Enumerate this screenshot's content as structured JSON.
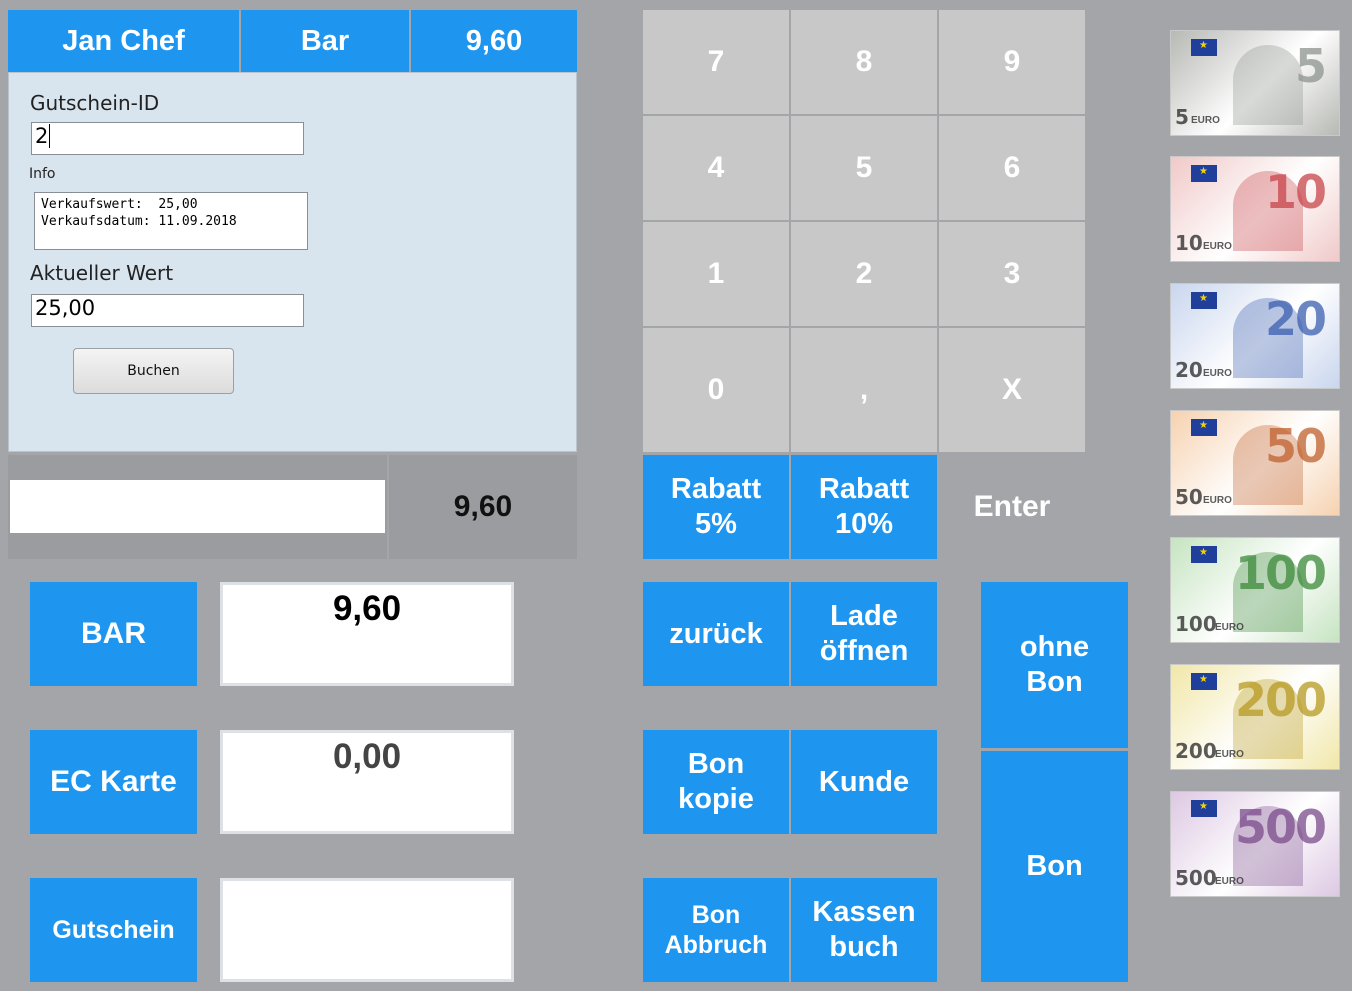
{
  "header": {
    "user": "Jan Chef",
    "mode": "Bar",
    "total": "9,60"
  },
  "voucher": {
    "id_label": "Gutschein-ID",
    "id_value": "2",
    "info_label": "Info",
    "info_lines": [
      "Verkaufswert:  25,00",
      "Verkaufsdatum: 11.09.2018"
    ],
    "current_label": "Aktueller Wert",
    "current_value": "25,00",
    "book_button": "Buchen"
  },
  "entry": {
    "value": "",
    "amount": "9,60"
  },
  "numpad": {
    "keys": [
      "7",
      "8",
      "9",
      "4",
      "5",
      "6",
      "1",
      "2",
      "3",
      "0",
      ",",
      "X"
    ],
    "discount5": [
      "Rabatt",
      "5%"
    ],
    "discount10": [
      "Rabatt",
      "10%"
    ],
    "enter": "Enter"
  },
  "payments": [
    {
      "label": "BAR",
      "value": "9,60"
    },
    {
      "label": "EC Karte",
      "value": "0,00"
    },
    {
      "label": "Gutschein",
      "value": ""
    }
  ],
  "actions": {
    "back": "zurück",
    "open_drawer": [
      "Lade",
      "öffnen"
    ],
    "receipt_copy": [
      "Bon",
      "kopie"
    ],
    "customer": "Kunde",
    "cancel_receipt": [
      "Bon",
      "Abbruch"
    ],
    "cash_book": [
      "Kassen",
      "buch"
    ],
    "no_receipt": [
      "ohne",
      "Bon"
    ],
    "receipt": "Bon"
  },
  "notes": [
    {
      "value": "5",
      "label": "EURO",
      "color": "#b7b9b4",
      "accent": "#8e9490"
    },
    {
      "value": "10",
      "label": "EURO",
      "color": "#f0c9c8",
      "accent": "#c8454a"
    },
    {
      "value": "20",
      "label": "EURO",
      "color": "#c9d6ee",
      "accent": "#3b5fb0"
    },
    {
      "value": "50",
      "label": "EURO",
      "color": "#f6d2b0",
      "accent": "#c0612d"
    },
    {
      "value": "100",
      "label": "EURO",
      "color": "#c6e4c1",
      "accent": "#3c8a3a"
    },
    {
      "value": "200",
      "label": "EURO",
      "color": "#f1e7a8",
      "accent": "#b79a22"
    },
    {
      "value": "500",
      "label": "EURO",
      "color": "#ddc8e3",
      "accent": "#7b4c8c"
    }
  ]
}
